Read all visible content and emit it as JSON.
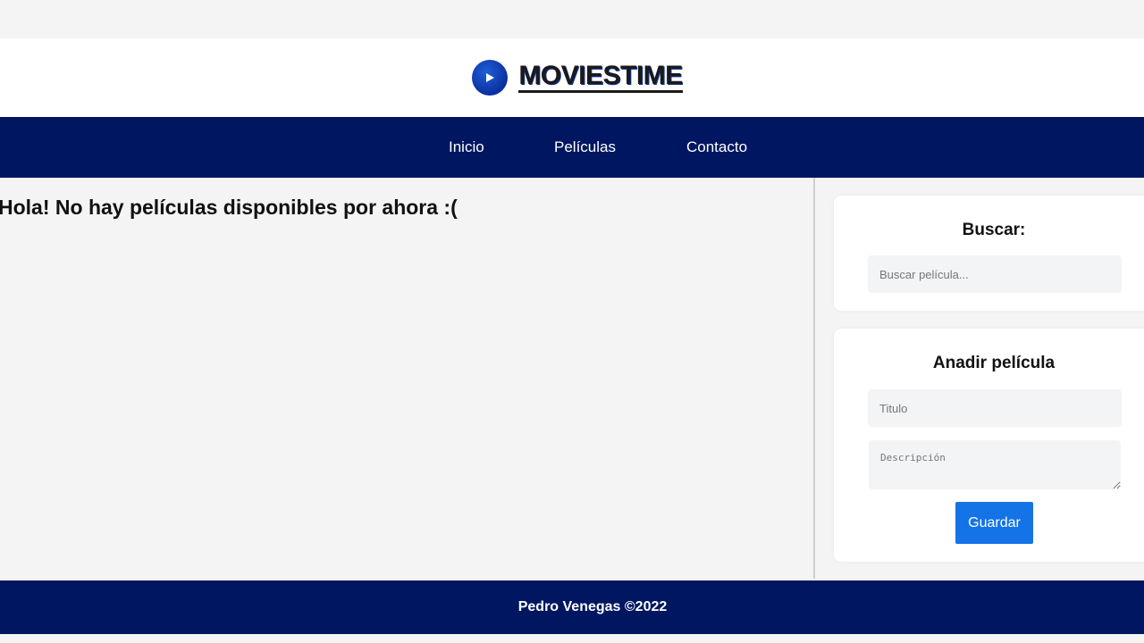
{
  "brand": {
    "name": "MOVIESTIME",
    "icon": "play-icon",
    "accent": "#0a2fa0"
  },
  "nav": {
    "items": [
      {
        "label": "Inicio"
      },
      {
        "label": "Películas"
      },
      {
        "label": "Contacto"
      }
    ],
    "background": "#001661"
  },
  "main": {
    "message": "Hola! No hay películas disponibles por ahora :("
  },
  "search": {
    "heading": "Buscar:",
    "placeholder": "Buscar película..."
  },
  "add_movie": {
    "heading": "Anadir película",
    "title_placeholder": "Titulo",
    "description_placeholder": "Descripción",
    "save_label": "Guardar",
    "button_color": "#1473e6"
  },
  "footer": {
    "text": "Pedro Venegas ©2022"
  }
}
